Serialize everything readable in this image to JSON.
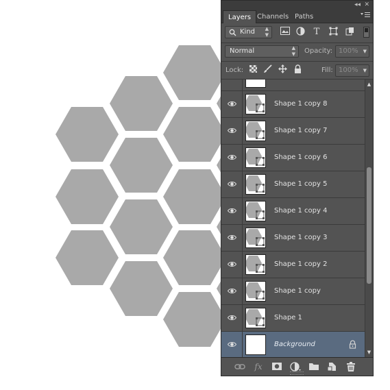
{
  "canvas": {
    "shape_color": "#a9a9a9",
    "background_color": "#ffffff",
    "shape": "hexagon"
  },
  "panel": {
    "title_controls": {
      "collapse": "◂◂",
      "close": "✕"
    },
    "tabs": [
      {
        "label": "Layers",
        "active": true
      },
      {
        "label": "Channels",
        "active": false
      },
      {
        "label": "Paths",
        "active": false
      }
    ],
    "menu_icon": "panel-menu-icon",
    "filter": {
      "kind_label": "Kind",
      "icons": [
        "image-filter-icon",
        "adjustment-filter-icon",
        "type-filter-icon",
        "shape-filter-icon",
        "smart-object-filter-icon"
      ]
    },
    "blend_mode": "Normal",
    "opacity": {
      "label": "Opacity:",
      "value": "100%"
    },
    "lock": {
      "label": "Lock:",
      "icons": [
        "lock-transparent-icon",
        "lock-image-icon",
        "lock-position-icon",
        "lock-all-icon"
      ]
    },
    "fill": {
      "label": "Fill:",
      "value": "100%"
    },
    "layers": [
      {
        "name": "Shape 1 copy 8",
        "visible": true,
        "type": "shape"
      },
      {
        "name": "Shape 1 copy 7",
        "visible": true,
        "type": "shape"
      },
      {
        "name": "Shape 1 copy 6",
        "visible": true,
        "type": "shape"
      },
      {
        "name": "Shape 1 copy 5",
        "visible": true,
        "type": "shape"
      },
      {
        "name": "Shape 1 copy 4",
        "visible": true,
        "type": "shape"
      },
      {
        "name": "Shape 1 copy 3",
        "visible": true,
        "type": "shape"
      },
      {
        "name": "Shape 1 copy 2",
        "visible": true,
        "type": "shape"
      },
      {
        "name": "Shape 1 copy",
        "visible": true,
        "type": "shape"
      },
      {
        "name": "Shape 1",
        "visible": true,
        "type": "shape"
      },
      {
        "name": "Background",
        "visible": true,
        "type": "background",
        "locked": true,
        "selected": true
      }
    ],
    "bottom_icons": [
      "link-layers-icon",
      "fx-icon",
      "add-mask-icon",
      "adjustment-layer-icon",
      "new-group-icon",
      "new-layer-icon",
      "delete-layer-icon"
    ],
    "scroll_fraction": 0.55,
    "selected_color": "#5a6b80"
  }
}
